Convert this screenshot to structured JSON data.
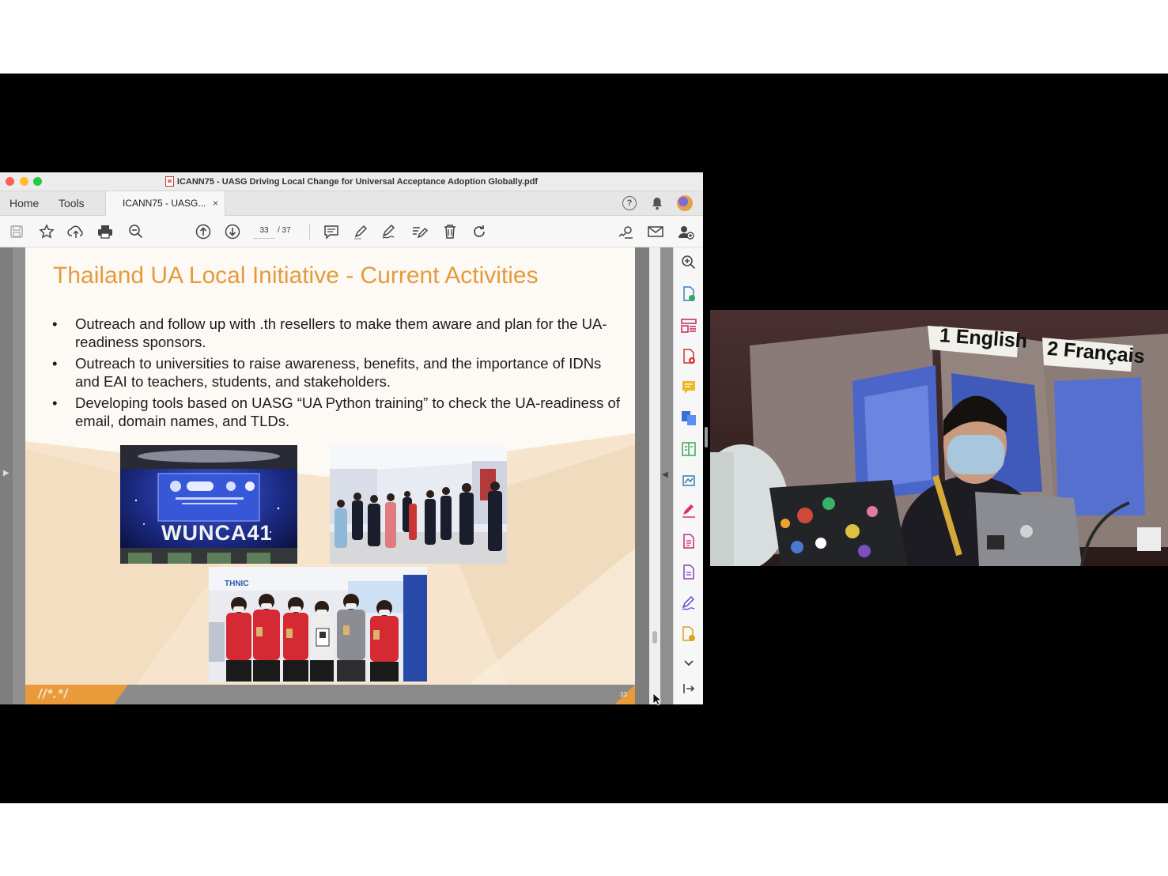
{
  "window": {
    "title": "ICANN75 - UASG Driving Local Change for Universal Acceptance Adoption Globally.pdf",
    "traffic_lights": [
      "#ff5f57",
      "#febc2e",
      "#28c840"
    ]
  },
  "tabs": {
    "home_label": "Home",
    "tools_label": "Tools",
    "document_tab_label": "ICANN75 - UASG...",
    "close_glyph": "×",
    "help_glyph": "?"
  },
  "toolbar": {
    "icons": [
      "save-icon",
      "star-icon",
      "upload-cloud-icon",
      "print-icon",
      "zoom-out-icon",
      "prev-page-icon",
      "next-page-icon",
      "comment-icon",
      "highlight-pen-icon",
      "sign-icon",
      "edit-icon",
      "delete-icon",
      "rotate-icon",
      "share-link-icon",
      "email-icon",
      "add-user-icon"
    ],
    "current_page": "33",
    "total_pages": "/ 37"
  },
  "slide": {
    "title": "Thailand UA Local Initiative - Current Activities",
    "bullets": [
      "Outreach and follow up with .th resellers to make them aware and plan for the UA-readiness sponsors.",
      "Outreach to universities to raise awareness, benefits, and the importance of IDNs and EAI to teachers, students, and stakeholders.",
      "Developing tools based on UASG “UA Python training”  to check the UA-readiness of email, domain names, and TLDs."
    ],
    "photo1_text": "WUNCA41",
    "photo3_logo": "THNIC",
    "footer_logo": "//*.*/",
    "page_number": "33",
    "accent_color": "#e69a3b"
  },
  "right_panel": {
    "icons": [
      "zoom-in-icon",
      "export-pdf-icon",
      "organize-pages-icon",
      "create-pdf-icon",
      "comment-icon",
      "combine-files-icon",
      "compress-icon",
      "scan-icon",
      "fill-sign-icon",
      "edit-pdf-icon",
      "protect-icon",
      "request-signature-icon",
      "send-for-review-icon",
      "more-tools-chevron-icon",
      "collapse-panel-icon"
    ]
  },
  "video": {
    "booth_labels": [
      "1  English",
      "2  Français"
    ]
  }
}
